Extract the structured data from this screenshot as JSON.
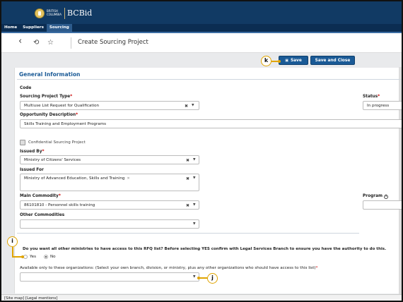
{
  "header": {
    "logo_text_small": "BRITISH COLUMBIA",
    "logo_text_big": "BCBid"
  },
  "nav": {
    "items": [
      {
        "label": "Home"
      },
      {
        "label": "Suppliers"
      },
      {
        "label": "Sourcing"
      }
    ]
  },
  "toolbar": {
    "back_icon": "‹",
    "history_icon": "⟲",
    "star_icon": "☆",
    "title": "Create Sourcing Project"
  },
  "actions": {
    "save_icon": "▣",
    "save_label": "Save",
    "save_close_label": "Save and Close"
  },
  "form": {
    "section_title": "General Information",
    "code_label": "Code",
    "project_type_label": "Sourcing Project Type",
    "project_type_value": "Multiuse List Request for Qualification",
    "status_label": "Status",
    "status_value": "In progress",
    "opportunity_label": "Opportunity Description",
    "opportunity_value": "Skills Training and Employment Programs",
    "confidential_label": "Confidential Sourcing Project",
    "issued_by_label": "Issued By",
    "issued_by_value": "Ministry of Citizens' Services",
    "issued_for_label": "Issued For",
    "issued_for_value": "Ministry of Advanced Education, Skills and Training",
    "main_commodity_label": "Main Commodity",
    "main_commodity_value": "86101810 - Personnel skills training",
    "program_label": "Program",
    "other_commodities_label": "Other Commodities",
    "access_question": "Do you want all other ministries to have access to this RFQ list? Before selecting YES confirm with Legal Services Branch to ensure you have the authority to do this.",
    "radio_yes": "Yes",
    "radio_no": "No",
    "available_label": "Available only to these organizations: (Select your own branch, division, or ministry, plus any other organizations who should have access to this list)",
    "required_mark": "*",
    "clear_icon": "✖",
    "dropdown_icon": "▼",
    "tag_remove_icon": "✕",
    "info_icon": "i"
  },
  "callouts": {
    "k": "k",
    "i": "i",
    "j": "j"
  },
  "footer": {
    "site_map": "[Site map]",
    "legal": "[Legal mentions]"
  },
  "colors": {
    "header_bg": "#113a64",
    "primary_button": "#1a5a96",
    "callout": "#e0a400"
  }
}
